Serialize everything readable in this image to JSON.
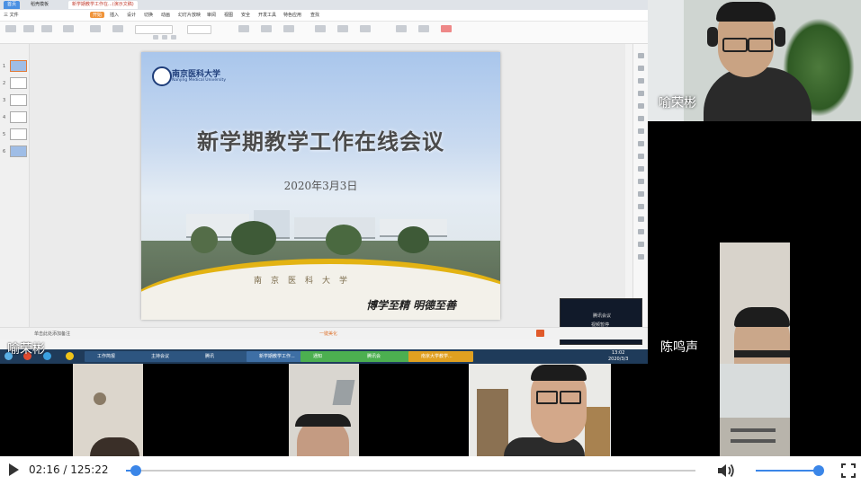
{
  "share": {
    "tabs": [
      "首页",
      "稻壳模板",
      "新学期教学工作在...(演示文稿)"
    ],
    "menus": [
      "三 文件",
      "开始",
      "插入",
      "设计",
      "切换",
      "动画",
      "幻灯片放映",
      "审阅",
      "视图",
      "安全",
      "开发工具",
      "特色应用",
      "查找"
    ],
    "thumb_numbers": [
      "1",
      "2",
      "3",
      "4",
      "5",
      "6"
    ],
    "slide": {
      "university_cn": "南京医科大学",
      "university_en": "Nanjing Medical University",
      "title": "新学期教学工作在线会议",
      "date": "2020年3月3日",
      "gate_text": "南京医科大学",
      "motto": "博学至精 明德至善"
    },
    "status_left": "单击此处添加备注",
    "status_center": "一键美化",
    "mini_panel": {
      "line1": "腾讯会议",
      "line2": "视频暂停"
    },
    "sharer_name": "喻荣彬",
    "taskbar_windows": [
      "工作简报",
      "主持会议",
      "腾讯",
      "新学期教学工作...",
      "通知",
      "腾讯会",
      "南京大学教学..."
    ],
    "clock": {
      "time": "13:02",
      "date": "2020/3/3"
    }
  },
  "participants": {
    "top_right_name": "喻荣彬",
    "mid_right_name": "陈鸣声"
  },
  "controls": {
    "current_time": "02:16",
    "total_time": "125:22",
    "time_display": "02:16 / 125:22",
    "progress": 0.018,
    "volume": 0.9
  }
}
